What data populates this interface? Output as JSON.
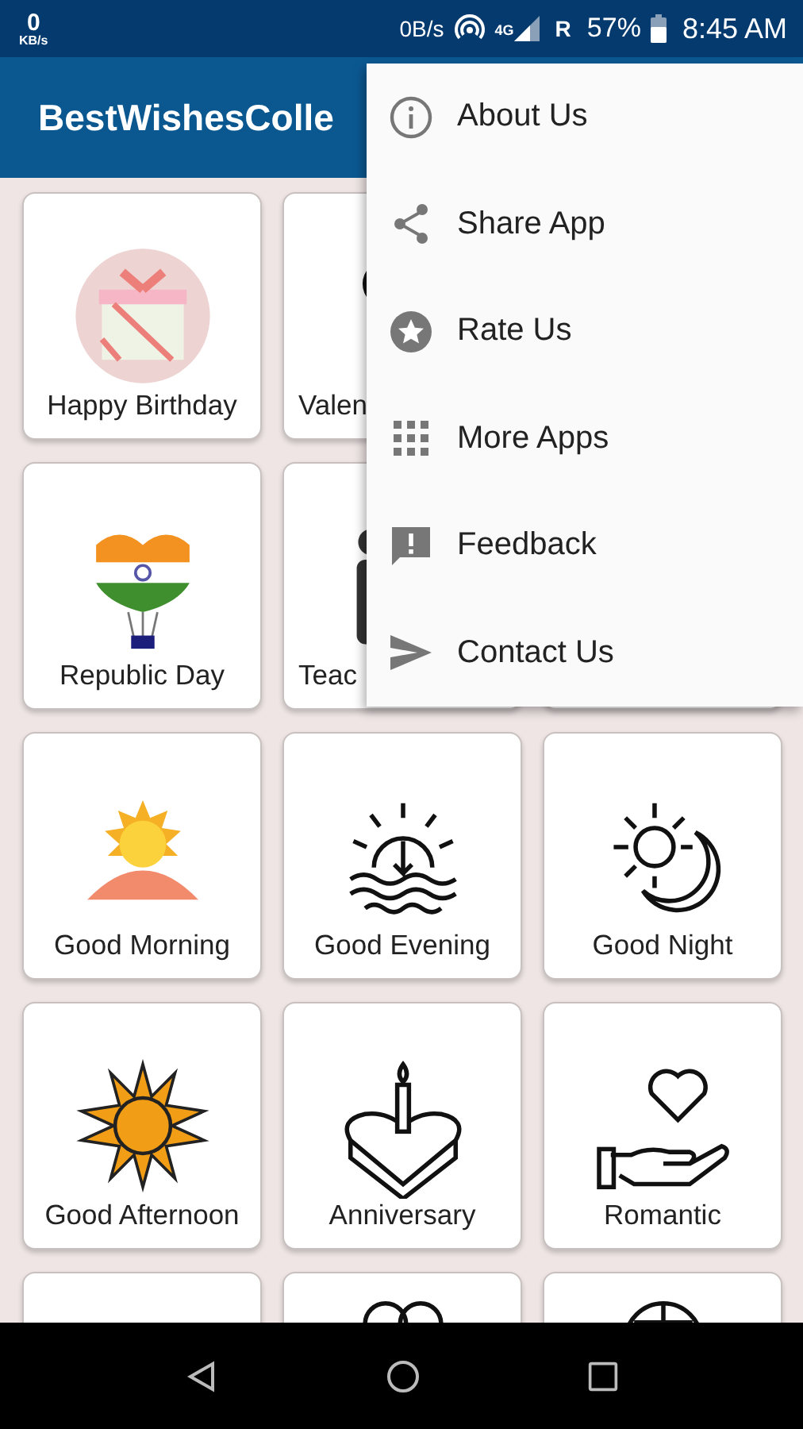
{
  "status_bar": {
    "speed_value": "0",
    "speed_unit": "KB/s",
    "data_rate": "0B/s",
    "network": "4G",
    "roaming": "R",
    "battery": "57%",
    "time": "8:45 AM"
  },
  "app_bar": {
    "title": "BestWishesColle"
  },
  "cards": [
    {
      "label": "Happy Birthday"
    },
    {
      "label": "Valen"
    },
    {
      "label": "Republic Day"
    },
    {
      "label": "Teac"
    },
    {
      "label": "Good Morning"
    },
    {
      "label": "Good Evening"
    },
    {
      "label": "Good Night"
    },
    {
      "label": "Good Afternoon"
    },
    {
      "label": "Anniversary"
    },
    {
      "label": "Romantic"
    }
  ],
  "menu": [
    {
      "label": "About Us"
    },
    {
      "label": "Share App"
    },
    {
      "label": "Rate Us"
    },
    {
      "label": "More Apps"
    },
    {
      "label": "Feedback"
    },
    {
      "label": "Contact Us"
    }
  ]
}
